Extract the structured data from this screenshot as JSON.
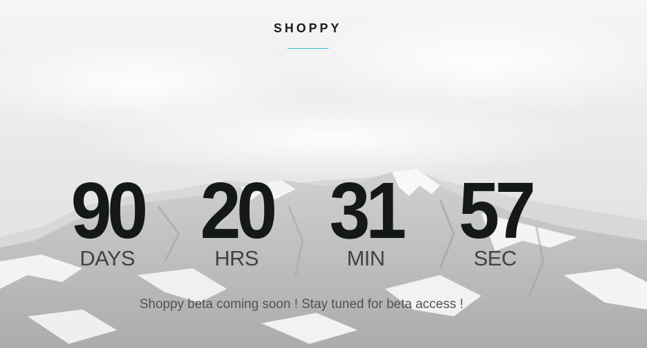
{
  "brand": {
    "title": "SHOPPY",
    "accent_color": "#2cc6d8"
  },
  "countdown": [
    {
      "value": "90",
      "label": "DAYS"
    },
    {
      "value": "20",
      "label": "HRS"
    },
    {
      "value": "31",
      "label": "MIN"
    },
    {
      "value": "57",
      "label": "SEC"
    }
  ],
  "message": "Shoppy beta coming soon ! Stay tuned for beta access !",
  "background": {
    "icon": "snowy-mountain-background"
  }
}
